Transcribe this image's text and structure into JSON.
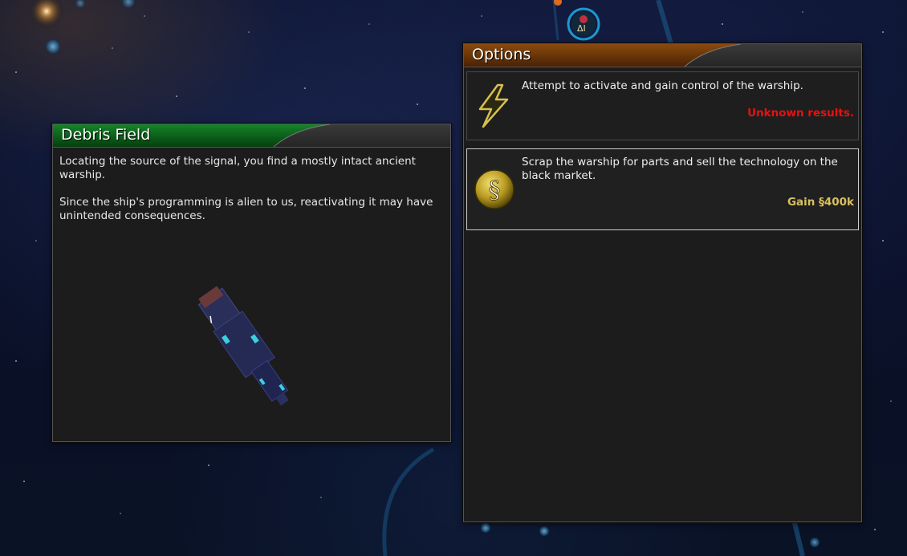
{
  "event": {
    "title": "Debris Field",
    "description_1": "Locating the source of the signal, you find a mostly intact ancient warship.",
    "description_2": "Since the ship's programming is alien to us, reactivating it may have unintended consequences."
  },
  "options_panel": {
    "title": "Options",
    "options": [
      {
        "icon": "lightning-icon",
        "text": "Attempt to activate and gain control of the warship.",
        "result": "Unknown results.",
        "result_color": "#e81010",
        "selected": false
      },
      {
        "icon": "credits-coin-icon",
        "text": "Scrap the warship for parts and sell the technology on the black market.",
        "result": "Gain §400k",
        "result_color": "#d8c060",
        "selected": true
      }
    ]
  },
  "colors": {
    "event_header_accent": "#0f6a1a",
    "options_header_accent": "#6a3a0a",
    "panel_background": "#1c1c1c"
  }
}
